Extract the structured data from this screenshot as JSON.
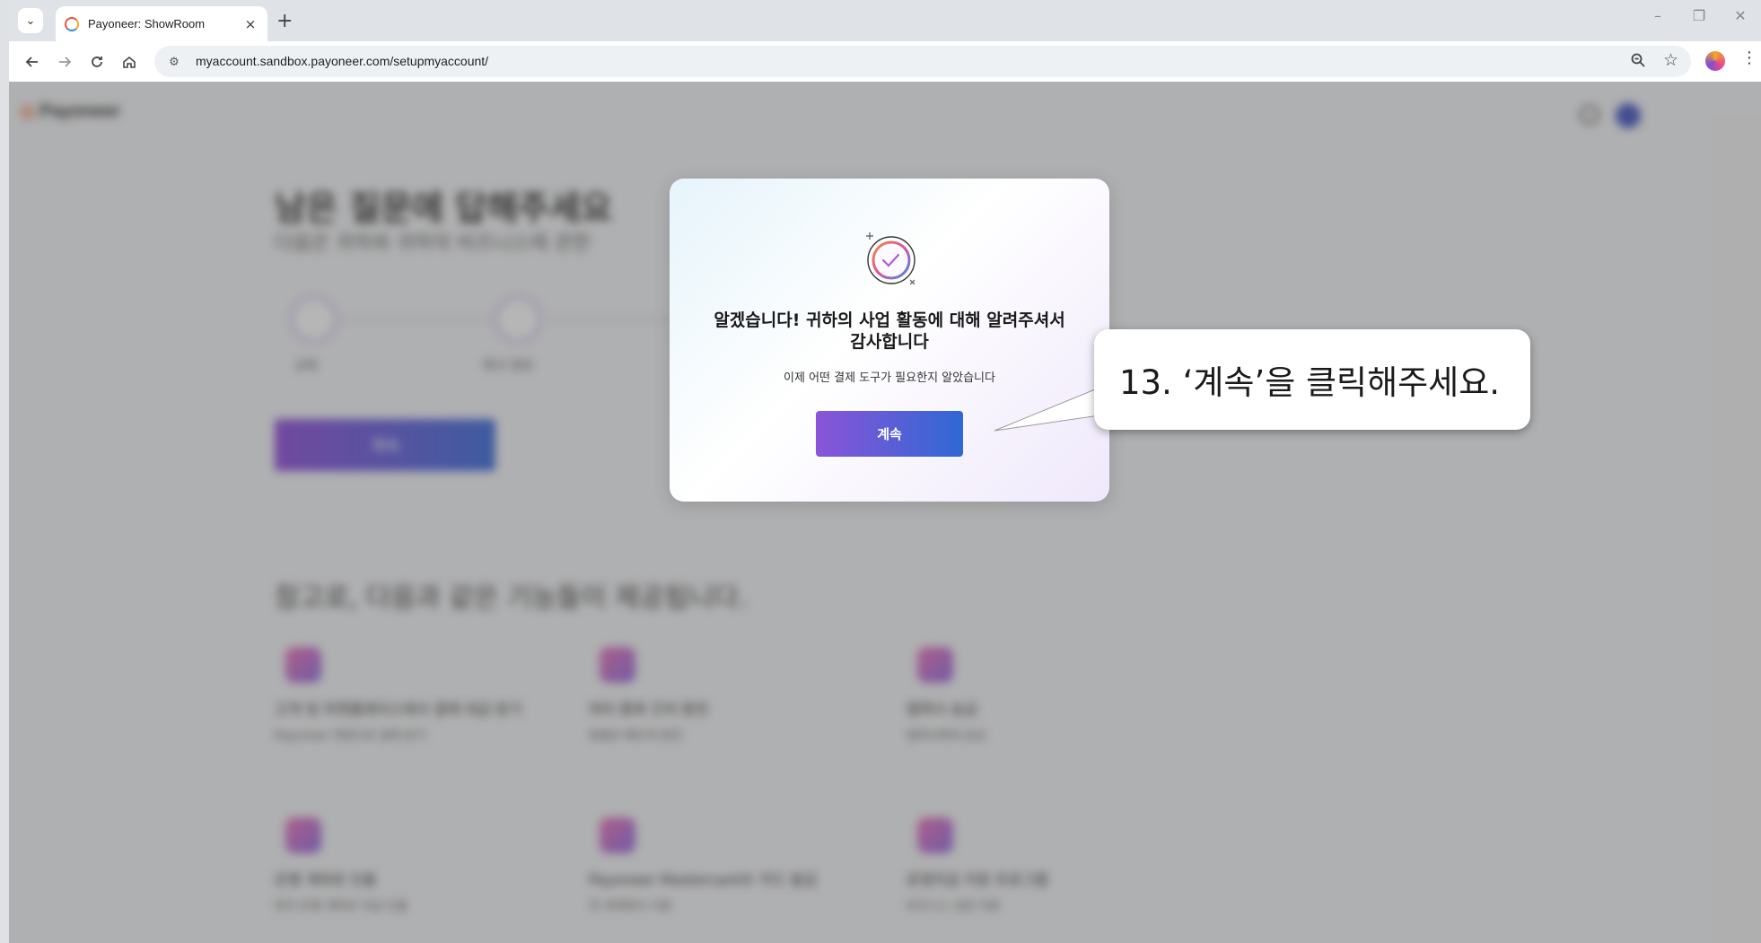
{
  "browser": {
    "tab_title": "Payoneer: ShowRoom",
    "url": "myaccount.sandbox.payoneer.com/setupmyaccount/",
    "new_tab": "+",
    "tab_close": "×",
    "window_controls": [
      "–",
      "❐",
      "✕"
    ],
    "icons": {
      "back": "arrow-left-icon",
      "forward": "arrow-right-icon",
      "reload": "reload-icon",
      "home": "home-icon",
      "site_info": "tune-icon",
      "zoom": "zoom-icon",
      "bookmark": "star-icon",
      "menu": "more-vert-icon"
    }
  },
  "background_page": {
    "logo": "Payoneer",
    "heading": "남은 질문에 답해주세요",
    "subheading": "다음은 귀하와 귀하의 비즈니스에 관한",
    "steps": [
      "교육",
      "회사 정보"
    ],
    "button": "계속",
    "features_heading": "참고로, 다음과 같은 기능들이 제공됩니다.",
    "features": [
      {
        "title": "고객 및 마켓플레이스에서 결제 대금 받기",
        "desc": "Payoneer 계정으로 결제 받기"
      },
      {
        "title": "여러 통화 간의 환전",
        "desc": "환율로 빠르게 환전"
      },
      {
        "title": "협력사 송금",
        "desc": "협력사에게 송금"
      },
      {
        "title": "은행 계좌로 인출",
        "desc": "현지 은행 계좌로 자금 인출"
      },
      {
        "title": "Payoneer Mastercard® 카드 발급",
        "desc": "전 세계에서 사용"
      },
      {
        "title": "운영자금 지원 프로그램",
        "desc": "비즈니스 성장 지원"
      }
    ]
  },
  "modal": {
    "title": "알겠습니다! 귀하의 사업 활동에 대해 알려주셔서 감사합니다",
    "description": "이제 어떤 결제 도구가 필요한지 알았습니다",
    "button": "계속",
    "illustration": "check-badge-icon"
  },
  "callout": {
    "text": "13. ‘계속’을 클릭해주세요."
  },
  "colors": {
    "button_gradient_start": "#8a54d8",
    "button_gradient_end": "#2f68d4",
    "overlay": "rgba(80,80,80,0.42)"
  }
}
